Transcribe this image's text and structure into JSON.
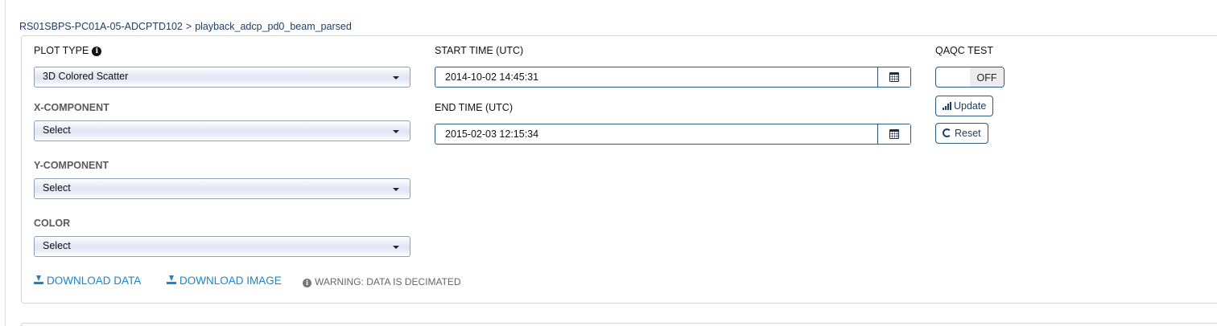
{
  "breadcrumb": {
    "instrument": "RS01SBPS-PC01A-05-ADCPTD102",
    "separator": ">",
    "stream": "playback_adcp_pd0_beam_parsed"
  },
  "plot_type": {
    "label": "PLOT TYPE",
    "info_icon": "info-circle-icon",
    "selected": "3D Colored Scatter"
  },
  "x_component": {
    "label": "X-COMPONENT",
    "selected": "Select"
  },
  "y_component": {
    "label": "Y-COMPONENT",
    "selected": "Select"
  },
  "color": {
    "label": "COLOR",
    "selected": "Select"
  },
  "start_time": {
    "label": "START TIME (UTC)",
    "value": "2014-10-02 14:45:31",
    "icon": "calendar-icon"
  },
  "end_time": {
    "label": "END TIME (UTC)",
    "value": "2015-02-03 12:15:34",
    "icon": "calendar-icon"
  },
  "qaqc": {
    "label": "QAQC TEST",
    "toggle_state": "OFF"
  },
  "buttons": {
    "update": "Update",
    "reset": "Reset"
  },
  "links": {
    "download_data": "DOWNLOAD DATA",
    "download_image": "DOWNLOAD IMAGE"
  },
  "warning": "WARNING: DATA IS DECIMATED",
  "colors": {
    "link": "#1a84c7",
    "border": "#2d5a80",
    "select_gradient": "#e2e6f5"
  }
}
